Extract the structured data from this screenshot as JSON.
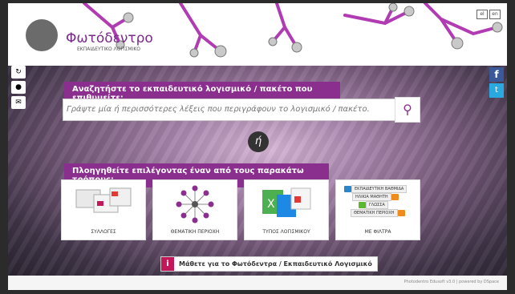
{
  "header": {
    "logo_title": "Φωτόδεντρο",
    "logo_subtitle": "ΕΚΠΑΙΔΕΥΤΙΚΟ ΛΟΓΙΣΜΙΚΟ",
    "lang_buttons": [
      "el",
      "en"
    ]
  },
  "search": {
    "banner": "Αναζητήστε το εκπαιδευτικό λογισμικό / πακέτο που επιθυμείτε:",
    "placeholder": "Γράψτε μία ή περισσότερες λέξεις που περιγράφουν το λογισμικό / πακέτο.",
    "button_icon": "search-icon"
  },
  "or_label": "ή",
  "ways": {
    "banner": "Πλοηγηθείτε επιλέγοντας έναν από τους παρακάτω τρόπους:",
    "cards": [
      {
        "label": "ΣΥΛΛΟΓΕΣ"
      },
      {
        "label": "ΘΕΜΑΤΙΚΗ ΠΕΡΙΟΧΗ"
      },
      {
        "label": "ΤΥΠΟΣ ΛΟΓΙΣΜΙΚΟΥ"
      },
      {
        "label": "ΜΕ ΦΙΛΤΡΑ"
      }
    ],
    "filters": [
      {
        "label": "ΕΚΠΑΙΔΕΥΤΙΚΗ ΒΑΘΜΙΔΑ",
        "color": "#2a86c8"
      },
      {
        "label": "ΗΛΙΚΙΑ ΜΑΘΗΤΗ",
        "color": "#f08c1e"
      },
      {
        "label": "ΓΛΩΣΣΑ",
        "color": "#5cb82e"
      },
      {
        "label": "ΘΕΜΑΤΙΚΗ ΠΕΡΙΟΧΗ",
        "color": "#f08c1e"
      }
    ]
  },
  "learn_more": "Μάθετε για το Φωτόδεντρα / Εκπαιδευτικό Λογισμικό",
  "footer": "Photodentro Edusoft v3.0 | powered by DSpace",
  "colors": {
    "accent": "#8a2f8d",
    "learn": "#c2185b"
  }
}
